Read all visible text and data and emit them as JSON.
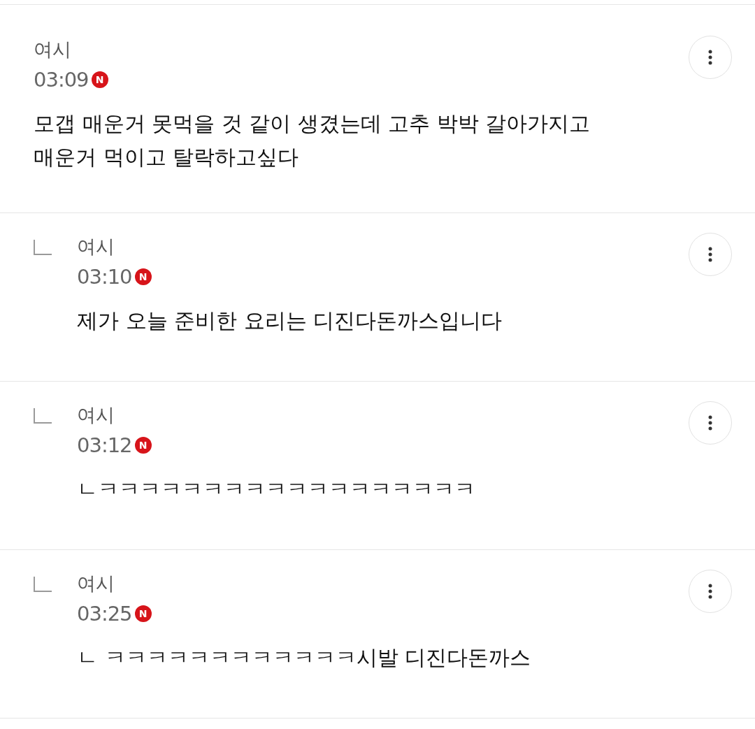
{
  "comments": [
    {
      "author": "여시",
      "time": "03:09",
      "badge": "N",
      "text": "모갭 매운거 못먹을 것 같이 생겼는데 고추 박박 갈아가지고 매운거 먹이고 탈락하고싶다",
      "children": [
        {
          "author": "여시",
          "time": "03:10",
          "badge": "N",
          "text": "제가 오늘 준비한 요리는 디진다돈까스입니다"
        },
        {
          "author": "여시",
          "time": "03:12",
          "badge": "N",
          "text": "ㄴㅋㅋㅋㅋㅋㅋㅋㅋㅋㅋㅋㅋㅋㅋㅋㅋㅋㅋ"
        },
        {
          "author": "여시",
          "time": "03:25",
          "badge": "N",
          "text": "ㄴ ㅋㅋㅋㅋㅋㅋㅋㅋㅋㅋㅋㅋ시발 디진다돈까스"
        }
      ]
    }
  ]
}
